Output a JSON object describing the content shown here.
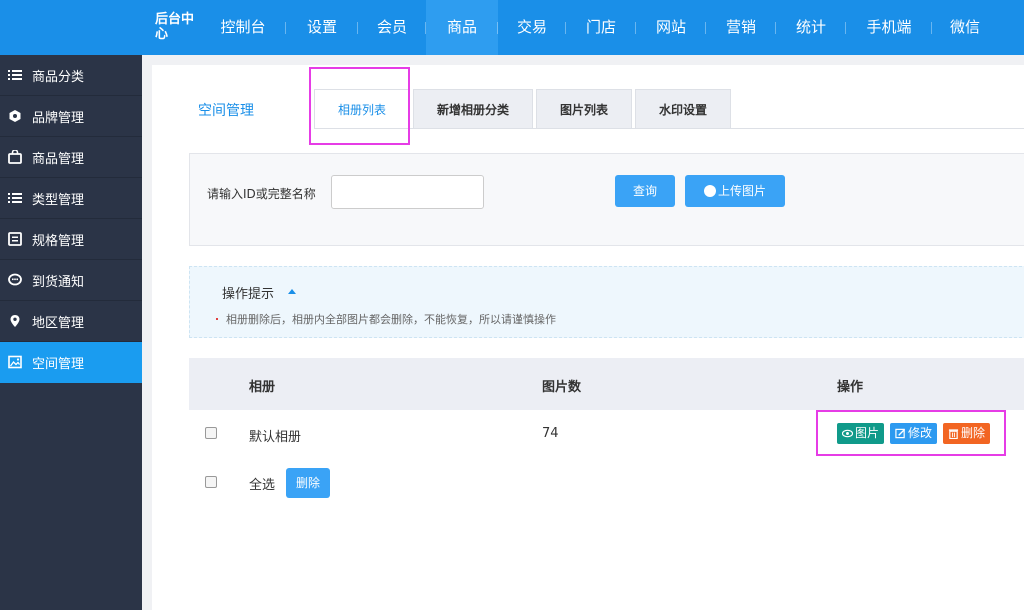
{
  "header": {
    "brand": "后台中心",
    "nav": [
      {
        "label": "控制台",
        "active": false
      },
      {
        "label": "设置",
        "active": false
      },
      {
        "label": "会员",
        "active": false
      },
      {
        "label": "商品",
        "active": true
      },
      {
        "label": "交易",
        "active": false
      },
      {
        "label": "门店",
        "active": false
      },
      {
        "label": "网站",
        "active": false
      },
      {
        "label": "营销",
        "active": false
      },
      {
        "label": "统计",
        "active": false
      },
      {
        "label": "手机端",
        "active": false
      },
      {
        "label": "微信",
        "active": false
      }
    ]
  },
  "sidebar": {
    "items": [
      {
        "label": "商品分类",
        "icon": "list-icon",
        "active": false
      },
      {
        "label": "品牌管理",
        "icon": "brand-icon",
        "active": false
      },
      {
        "label": "商品管理",
        "icon": "bag-icon",
        "active": false
      },
      {
        "label": "类型管理",
        "icon": "list-icon",
        "active": false
      },
      {
        "label": "规格管理",
        "icon": "spec-icon",
        "active": false
      },
      {
        "label": "到货通知",
        "icon": "chat-icon",
        "active": false
      },
      {
        "label": "地区管理",
        "icon": "location-icon",
        "active": false
      },
      {
        "label": "空间管理",
        "icon": "image-icon",
        "active": true
      }
    ]
  },
  "main": {
    "section_title": "空间管理",
    "tabs": [
      {
        "label": "相册列表",
        "active": true
      },
      {
        "label": "新增相册分类",
        "active": false
      },
      {
        "label": "图片列表",
        "active": false
      },
      {
        "label": "水印设置",
        "active": false
      }
    ],
    "search": {
      "label": "请输入ID或完整名称",
      "placeholder": "",
      "value": "",
      "query_label": "查询",
      "upload_label": "上传图片"
    },
    "tips": {
      "title": "操作提示",
      "text": "相册删除后，相册内全部图片都会删除，不能恢复，所以请谨慎操作"
    },
    "table": {
      "columns": [
        "相册",
        "图片数",
        "操作"
      ],
      "rows": [
        {
          "name": "默认相册",
          "count": "74",
          "checked": false
        }
      ],
      "actions": {
        "view": "图片",
        "edit": "修改",
        "delete": "删除"
      },
      "select_all_label": "全选",
      "delete_label": "删除"
    }
  },
  "colors": {
    "header_bg": "#1a8fe8",
    "sidebar_bg": "#2b3447",
    "sidebar_active": "#1a9cf0",
    "accent": "#1a8fe8",
    "view_btn": "#109a8a",
    "edit_btn": "#2d9af0",
    "delete_btn": "#f26522",
    "highlight": "#e63ce6"
  }
}
